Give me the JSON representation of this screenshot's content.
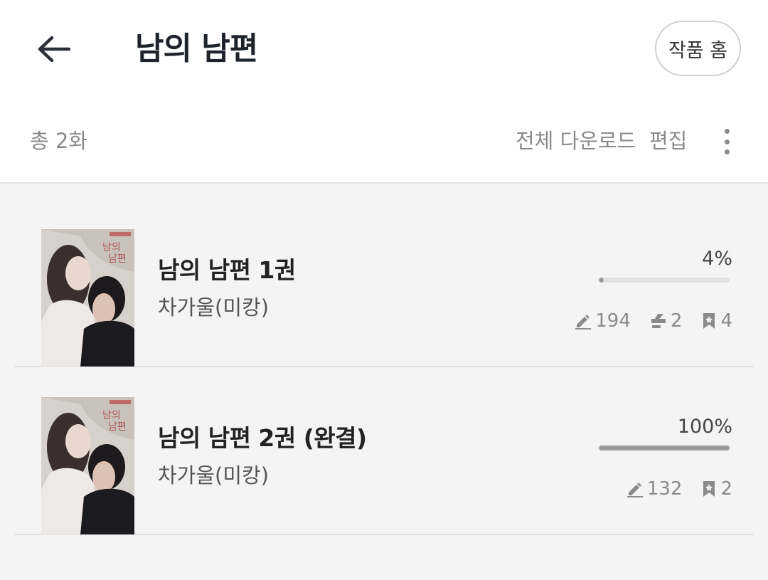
{
  "header": {
    "title": "남의 남편",
    "home_button": "작품 홈"
  },
  "subbar": {
    "count": "총 2화",
    "download_all": "전체 다운로드",
    "edit": "편집"
  },
  "items": [
    {
      "title": "남의 남편 1권",
      "author": "차가울(미캉)",
      "progress_label": "4%",
      "progress": 0.04,
      "stats": {
        "notes": "194",
        "highlights": "2",
        "bookmarks": "4"
      }
    },
    {
      "title": "남의 남편 2권 (완결)",
      "author": "차가울(미캉)",
      "progress_label": "100%",
      "progress": 1.0,
      "stats": {
        "notes": "132",
        "bookmarks": "2"
      }
    }
  ],
  "colors": {
    "title": "#1f232b",
    "muted": "#8a8a8a",
    "progress_fill": "#9b9b9b",
    "background": "#f4f4f4"
  },
  "icons": [
    "back-arrow-icon",
    "more-vert-icon",
    "pencil-icon",
    "highlight-icon",
    "bookmark-icon"
  ]
}
